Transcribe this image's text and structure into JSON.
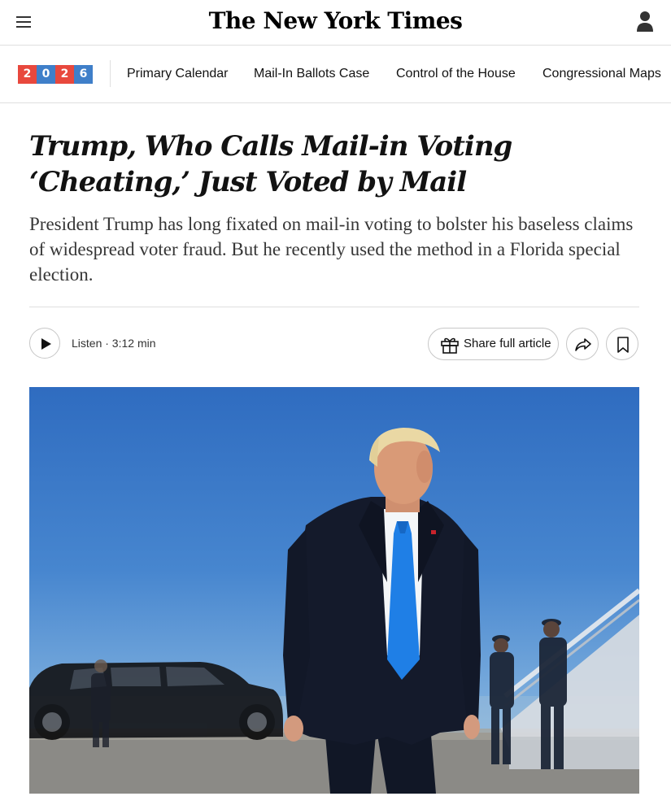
{
  "header": {
    "masthead": "The New York Times",
    "menu_icon": "hamburger-menu-icon",
    "account_icon": "user-account-icon"
  },
  "section_nav": {
    "badge_digits": [
      "2",
      "0",
      "2",
      "6"
    ],
    "links": [
      "Primary Calendar",
      "Mail-In Ballots Case",
      "Control of the House",
      "Congressional Maps"
    ]
  },
  "article": {
    "headline": "Trump, Who Calls Mail-in Voting ‘Cheating,’ Just Voted by Mail",
    "summary": "President Trump has long fixated on mail-in voting to bolster his baseless claims of widespread voter fraud. But he recently used the method in a Florida special election."
  },
  "actions": {
    "listen_label": "Listen · 3:12 min",
    "share_label": "Share full article",
    "icons": [
      "play-icon",
      "gift-icon",
      "share-arrow-icon",
      "bookmark-icon"
    ]
  },
  "colors": {
    "badge_red": "#e8483d",
    "badge_blue": "#3f7fc9",
    "sky": "#3f7fc9"
  }
}
